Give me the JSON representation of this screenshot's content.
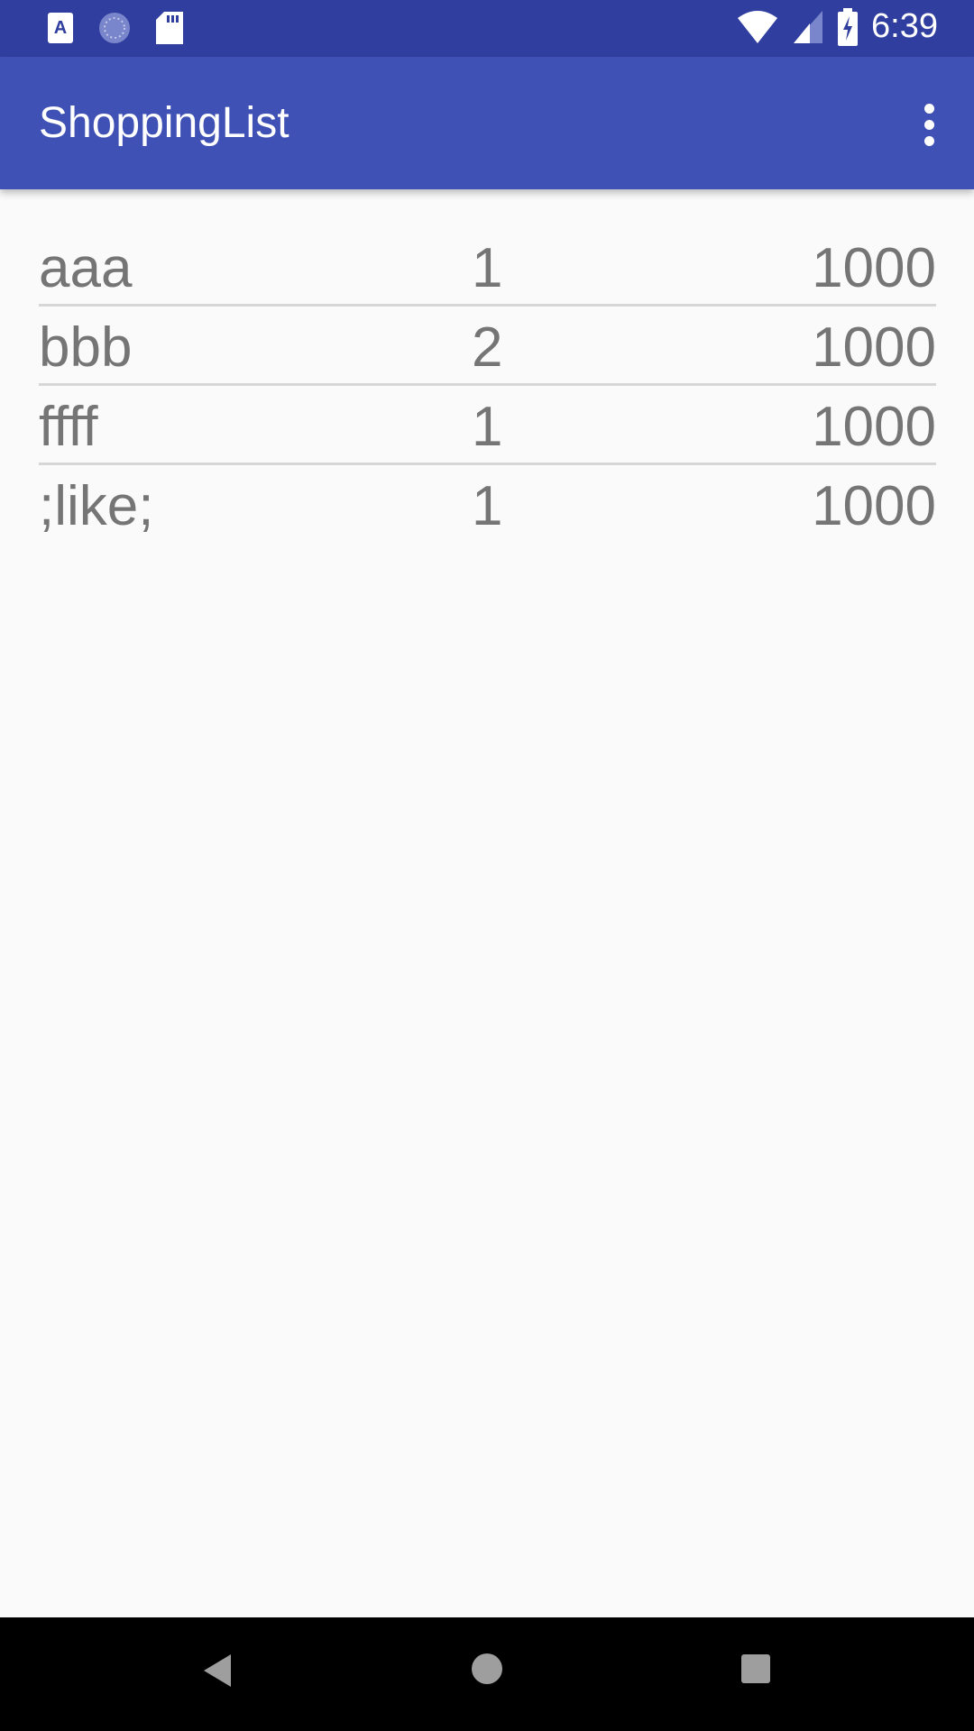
{
  "status_bar": {
    "time": "6:39",
    "icons": [
      "a11y-icon",
      "sync-icon",
      "sd-card-icon",
      "wifi-icon",
      "signal-icon",
      "battery-charging-icon"
    ]
  },
  "app_bar": {
    "title": "ShoppingList",
    "menu_icon": "more-vert-icon"
  },
  "items": [
    {
      "name": "aaa",
      "quantity": "1",
      "price": "1000"
    },
    {
      "name": "bbb",
      "quantity": "2",
      "price": "1000"
    },
    {
      "name": "ffff",
      "quantity": "1",
      "price": "1000"
    },
    {
      "name": ";like;",
      "quantity": "1",
      "price": "1000"
    }
  ],
  "colors": {
    "primary": "#3f51b5",
    "primary_dark": "#303f9f",
    "text": "#757575"
  }
}
